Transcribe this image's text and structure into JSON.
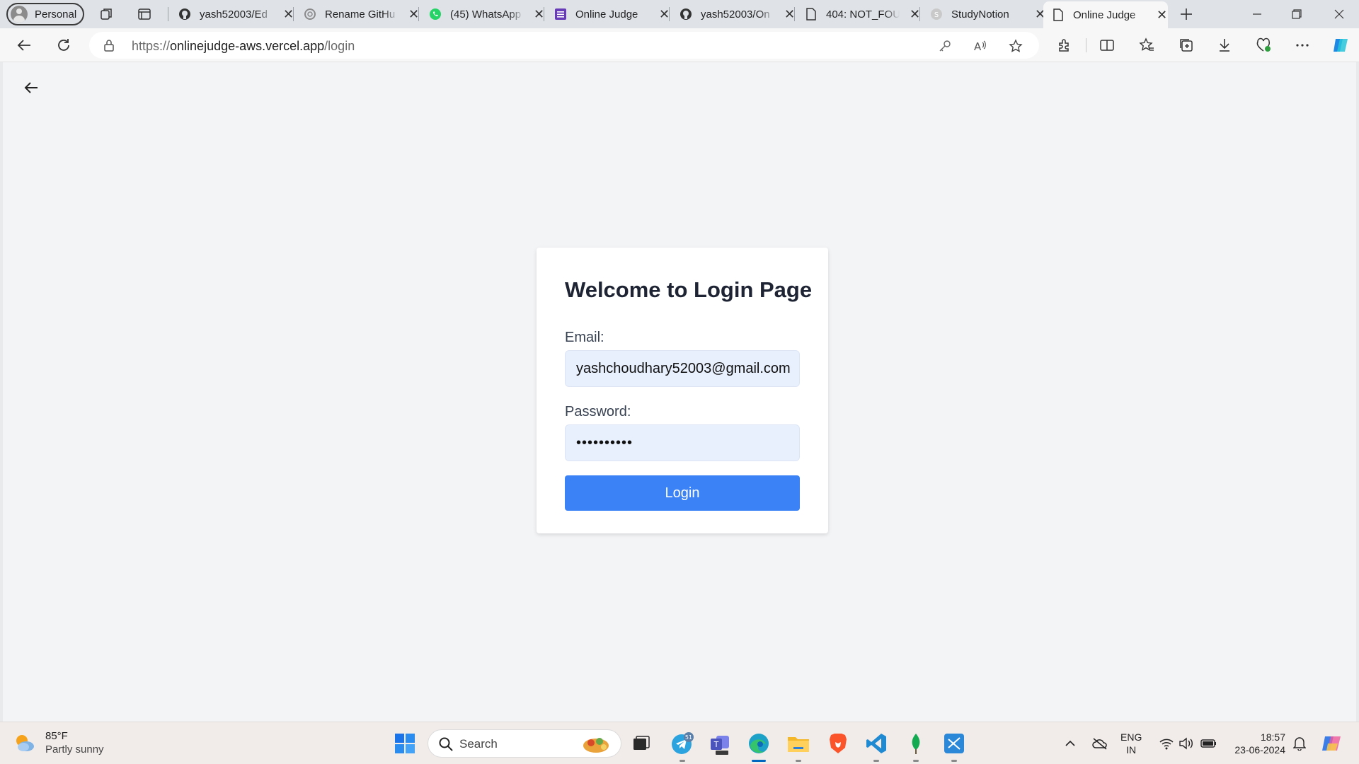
{
  "browser": {
    "profile_label": "Personal",
    "tabs": [
      {
        "title": "yash52003/Ed",
        "icon": "github-icon"
      },
      {
        "title": "Rename GitHu",
        "icon": "openai-icon"
      },
      {
        "title": "(45) WhatsApp",
        "icon": "whatsapp-icon"
      },
      {
        "title": "Online Judge",
        "icon": "form-icon"
      },
      {
        "title": "yash52003/On",
        "icon": "github-icon"
      },
      {
        "title": "404: NOT_FOU",
        "icon": "page-icon"
      },
      {
        "title": "StudyNotion",
        "icon": "studynotion-icon"
      },
      {
        "title": "Online Judge",
        "icon": "page-icon",
        "active": true
      }
    ],
    "url_scheme": "https://",
    "url_host": "onlinejudge-aws.vercel.app",
    "url_path": "/login"
  },
  "page": {
    "title": "Welcome to Login Page",
    "email_label": "Email:",
    "email_value": "yashchoudhary52003@gmail.com",
    "password_label": "Password:",
    "password_value": "••••••••••",
    "login_label": "Login",
    "accent_color": "#3b82f6"
  },
  "taskbar": {
    "weather_temp": "85°F",
    "weather_condition": "Partly sunny",
    "search_label": "Search",
    "telegram_badge": "51",
    "lang_line1": "ENG",
    "lang_line2": "IN",
    "time": "18:57",
    "date": "23-06-2024"
  }
}
